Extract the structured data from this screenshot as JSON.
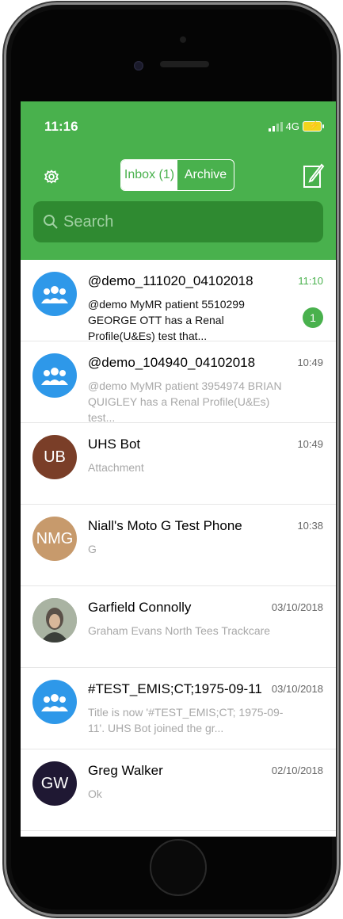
{
  "status_bar": {
    "time": "11:16",
    "network": "4G"
  },
  "header": {
    "tabs": [
      {
        "label": "Inbox (1)",
        "active": true
      },
      {
        "label": "Archive",
        "active": false
      }
    ],
    "search": {
      "placeholder": "Search"
    }
  },
  "colors": {
    "accent": "#49b14d",
    "search_bg": "#2f8a31",
    "group_avatar": "#2e98e9"
  },
  "conversations": [
    {
      "title": "@demo_111020_04102018",
      "time": "11:10",
      "preview": "@demo MyMR patient 5510299 GEORGE OTT has a Renal Profile(U&Es) test that...",
      "unread": true,
      "badge": "1",
      "avatar_type": "group-icon"
    },
    {
      "title": "@demo_104940_04102018",
      "time": "10:49",
      "preview": "@demo MyMR patient 3954974 BRIAN QUIGLEY has a Renal Profile(U&Es) test...",
      "unread": false,
      "avatar_type": "group-icon"
    },
    {
      "title": "UHS Bot",
      "time": "10:49",
      "preview": "Attachment",
      "unread": false,
      "avatar_initials": "UB",
      "avatar_color": "#7a3e28"
    },
    {
      "title": "Niall's Moto G Test Phone",
      "time": "10:38",
      "preview": "G",
      "unread": false,
      "avatar_initials": "NMG",
      "avatar_color": "#c79a6c"
    },
    {
      "title": "Garfield Connolly",
      "time": "03/10/2018",
      "preview": "Graham Evans North Tees Trackcare",
      "unread": false,
      "avatar_type": "photo"
    },
    {
      "title": "#TEST_EMIS;CT;1975-09-11",
      "time": "03/10/2018",
      "preview": "Title is now '#TEST_EMIS;CT; 1975-09-11'. UHS Bot joined the gr...",
      "unread": false,
      "avatar_type": "group-icon"
    },
    {
      "title": "Greg Walker",
      "time": "02/10/2018",
      "preview": "Ok",
      "unread": false,
      "avatar_initials": "GW",
      "avatar_color": "#1f1833"
    }
  ]
}
